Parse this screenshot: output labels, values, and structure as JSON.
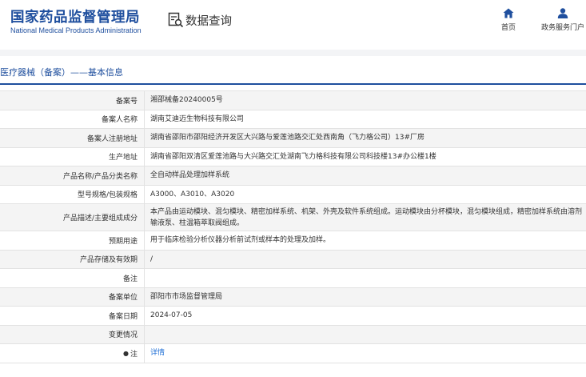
{
  "header": {
    "logo_cn": "国家药品监督管理局",
    "logo_en": "National Medical Products Administration",
    "query_title": "数据查询",
    "nav": [
      {
        "label": "首页",
        "icon": "home-icon"
      },
      {
        "label": "政务服务门户",
        "icon": "user-icon"
      }
    ]
  },
  "section": {
    "title": "医疗器械（备案）——基本信息"
  },
  "rows": [
    {
      "label": "备案号",
      "value": "湘邵械备20240005号"
    },
    {
      "label": "备案人名称",
      "value": "湖南艾迪迈生物科技有限公司"
    },
    {
      "label": "备案人注册地址",
      "value": "湖南省邵阳市邵阳经济开发区大兴路与爱莲池路交汇处西南角（飞力格公司）13#厂房"
    },
    {
      "label": "生产地址",
      "value": "湖南省邵阳双清区爱莲池路与大兴路交汇处湖南飞力格科技有限公司科技楼13#办公楼1楼"
    },
    {
      "label": "产品名称/产品分类名称",
      "value": "全自动样品处理加样系统"
    },
    {
      "label": "型号规格/包装规格",
      "value": "A3000、A3010、A3020"
    },
    {
      "label": "产品描述/主要组成成分",
      "value": "本产品由运动模块、混匀模块、精密加样系统、机架、外壳及软件系统组成。运动模块由分杯模块，混匀模块组成，精密加样系统由溶剂输液泵、柱温箱萃取阀组成。"
    },
    {
      "label": "预期用途",
      "value": "用于临床检验分析仪器分析前试剂或样本的处理及加样。"
    },
    {
      "label": "产品存储及有效期",
      "value": "/"
    },
    {
      "label": "备注",
      "value": ""
    },
    {
      "label": "备案单位",
      "value": "邵阳市市场监督管理局"
    },
    {
      "label": "备案日期",
      "value": "2024-07-05"
    },
    {
      "label": "变更情况",
      "value": ""
    },
    {
      "label": "注",
      "value": "详情",
      "warn": "●"
    }
  ],
  "colors": {
    "brand": "#1f4f9e",
    "link": "#1f6fd6"
  }
}
